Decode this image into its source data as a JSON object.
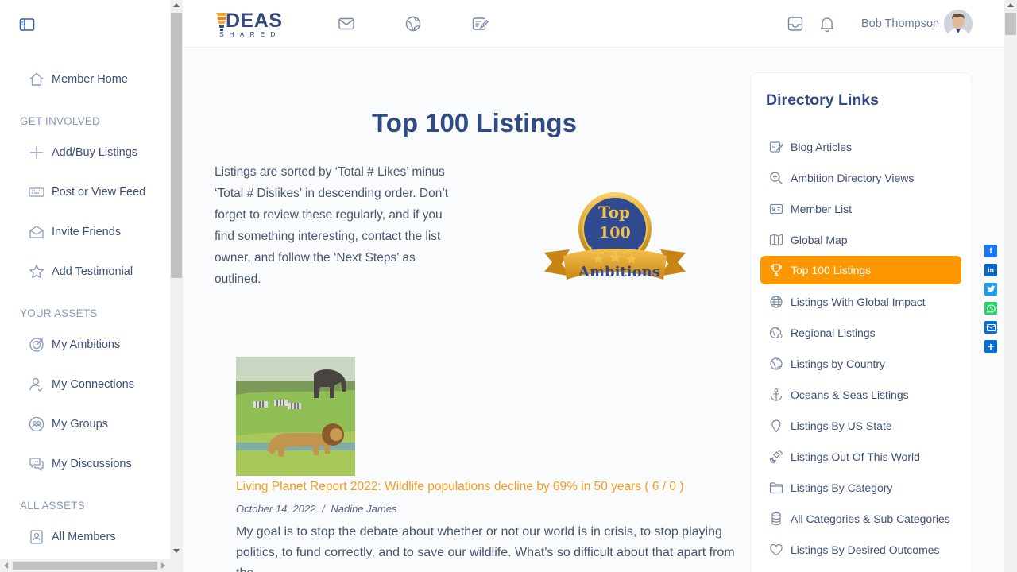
{
  "colors": {
    "accent": "#ff9800",
    "brand": "#2f4a84",
    "link_orange": "#f39c1e",
    "nav_text": "#3e5079",
    "section_text": "#8a9bc0"
  },
  "logo": {
    "big": "DEAS",
    "small": "SHARED",
    "icon": "lightbulb-logo"
  },
  "header": {
    "icons": [
      "mail-icon",
      "globe-icon",
      "edit-note-icon",
      "inbox-icon",
      "bell-icon"
    ],
    "user_name": "Bob Thompson"
  },
  "sidebar": {
    "home": "Member Home",
    "get_involved": {
      "heading": "GET INVOLVED",
      "items": [
        "Add/Buy Listings",
        "Post or View Feed",
        "Invite Friends",
        "Add Testimonial"
      ]
    },
    "your_assets": {
      "heading": "YOUR ASSETS",
      "items": [
        "My Ambitions",
        "My Connections",
        "My Groups",
        "My Discussions"
      ]
    },
    "all_assets": {
      "heading": "ALL ASSETS",
      "items": [
        "All Members"
      ]
    }
  },
  "main": {
    "title": "Top 100 Listings",
    "intro": "Listings are sorted by ‘Total # Likes’ minus ‘Total # Dislikes’ in descending order. Don’t forget to review these regularly, and if you find something interesting, contact the list owner, and follow the ‘Next Steps’ as outlined.",
    "badge": {
      "line1": "Top",
      "line2": "100",
      "ribbon": "Ambitions"
    },
    "post": {
      "title": "Living Planet Report 2022: Wildlife populations decline by 69% in 50 years ( 6 / 0 )",
      "date": "October 14, 2022",
      "separator": "/",
      "author": "Nadine James",
      "body": "My goal is to stop the debate about whether or not our world is in crisis, to stop playing politics, to fund correctly, and to save our wildlife. What's so difficult about that apart from the..."
    }
  },
  "directory": {
    "title": "Directory Links",
    "items": [
      {
        "label": "Blog Articles",
        "icon": "blog-icon"
      },
      {
        "label": "Ambition Directory Views",
        "icon": "zoom-icon"
      },
      {
        "label": "Member List",
        "icon": "id-card-icon"
      },
      {
        "label": "Global Map",
        "icon": "map-icon"
      },
      {
        "label": "Top 100 Listings",
        "icon": "trophy-icon",
        "active": true
      },
      {
        "label": "Listings With Global Impact",
        "icon": "globe-icon"
      },
      {
        "label": "Regional Listings",
        "icon": "regional-globe-icon"
      },
      {
        "label": "Listings by Country",
        "icon": "country-globe-icon"
      },
      {
        "label": "Oceans & Seas Listings",
        "icon": "anchor-icon"
      },
      {
        "label": "Listings By US State",
        "icon": "map-pin-icon"
      },
      {
        "label": "Listings Out Of This World",
        "icon": "satellite-icon"
      },
      {
        "label": "Listings By Category",
        "icon": "folder-icon"
      },
      {
        "label": "All Categories & Sub Categories",
        "icon": "database-icon"
      },
      {
        "label": "Listings By Desired Outcomes",
        "icon": "heart-icon"
      }
    ]
  },
  "share": [
    {
      "name": "facebook-share-icon",
      "glyph": "f",
      "color": "#1877f2"
    },
    {
      "name": "linkedin-share-icon",
      "glyph": "in",
      "color": "#0a66c2"
    },
    {
      "name": "twitter-share-icon",
      "glyph": "t",
      "color": "#1d9bf0"
    },
    {
      "name": "whatsapp-share-icon",
      "glyph": "w",
      "color": "#25d366"
    },
    {
      "name": "email-share-icon",
      "glyph": "✉",
      "color": "#0a6cd6"
    },
    {
      "name": "more-share-icon",
      "glyph": "+",
      "color": "#0a6cd6"
    }
  ]
}
